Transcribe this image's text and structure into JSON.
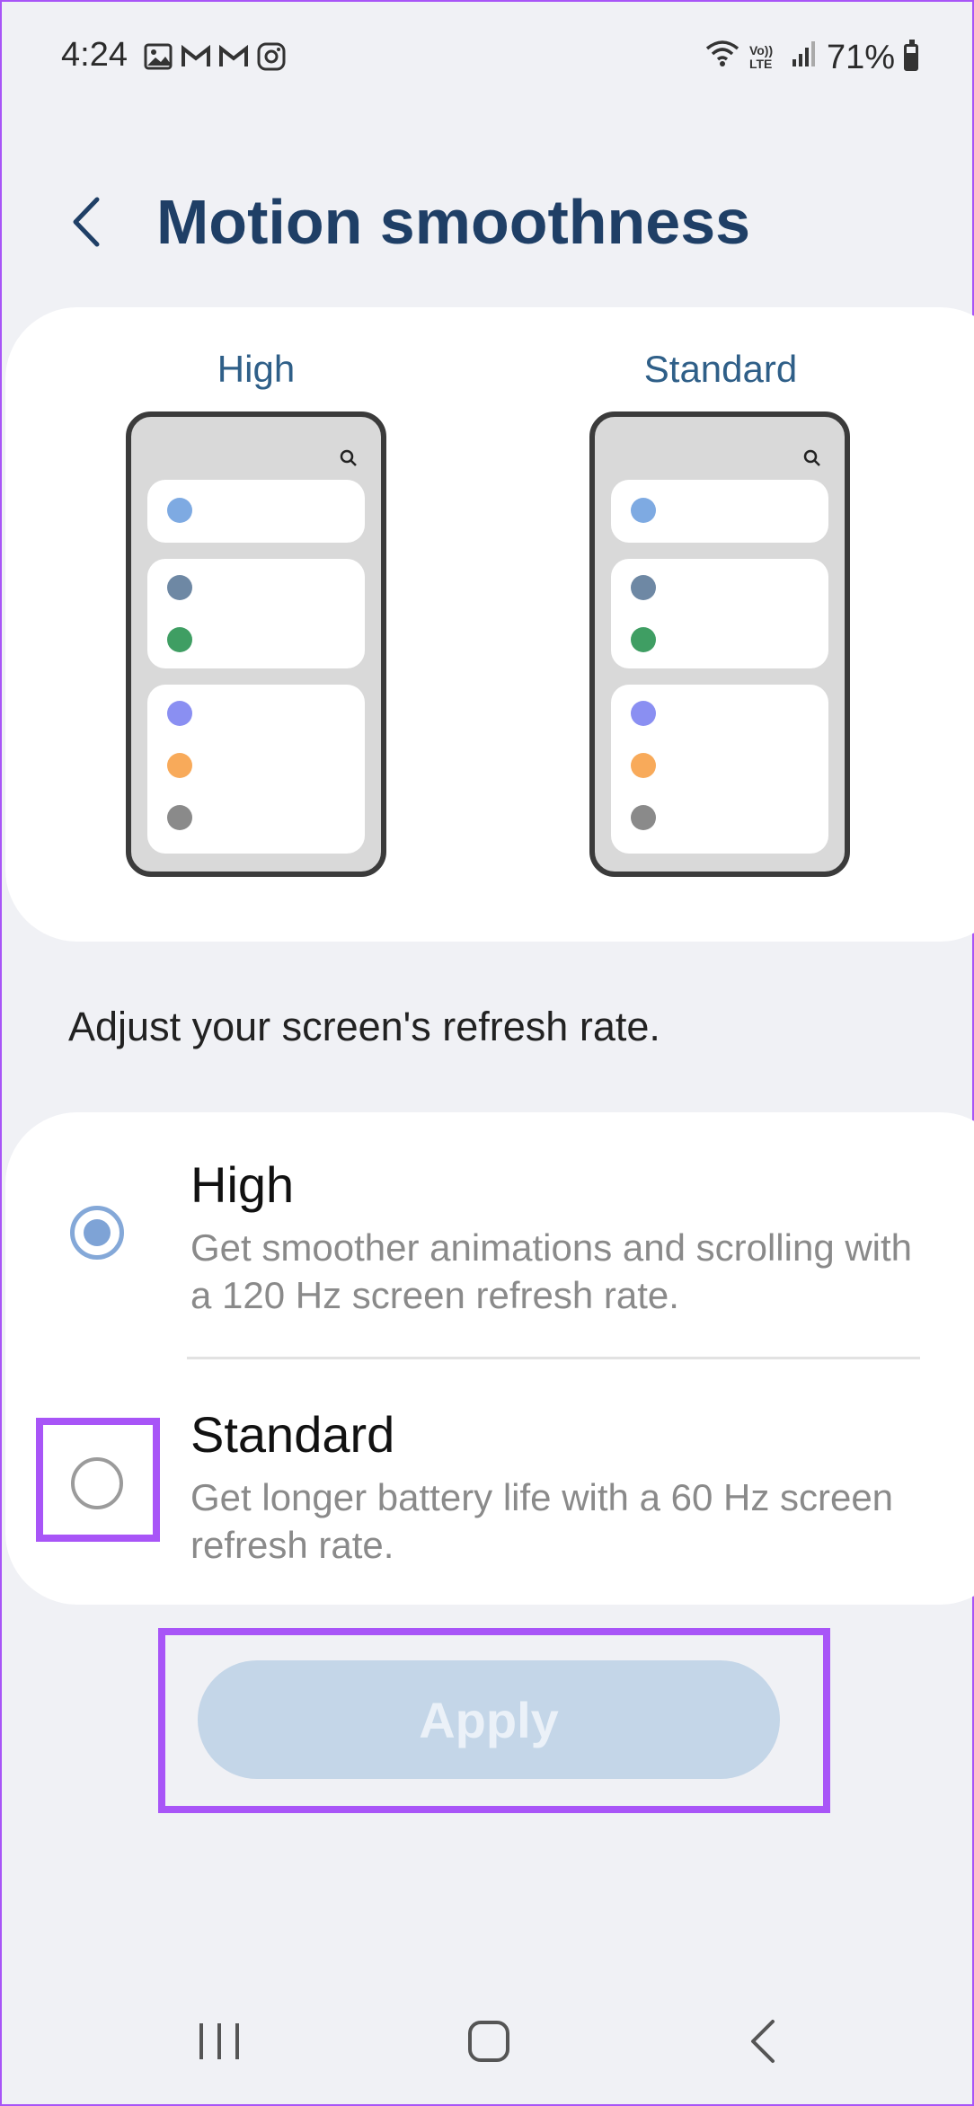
{
  "status_bar": {
    "time": "4:24",
    "battery": "71%",
    "icons_left": [
      "gallery-icon",
      "gmail-icon",
      "gmail-icon",
      "instagram-icon"
    ],
    "icons_right": [
      "wifi-icon",
      "volte-icon",
      "signal-icon",
      "battery-icon"
    ],
    "volte_text": "Vo)) LTE"
  },
  "header": {
    "title": "Motion smoothness"
  },
  "preview": {
    "high_label": "High",
    "standard_label": "Standard"
  },
  "description": "Adjust your screen's refresh rate.",
  "options": [
    {
      "title": "High",
      "description": "Get smoother animations and scrolling with a 120 Hz screen refresh rate.",
      "selected": true
    },
    {
      "title": "Standard",
      "description": "Get longer battery life with a 60 Hz screen refresh rate.",
      "selected": false
    }
  ],
  "apply_button": "Apply",
  "colors": {
    "accent": "#1f3f66",
    "highlight": "#a855f7",
    "apply_bg": "#c4d6e8",
    "radio": "#7ea3d6"
  },
  "navigation": [
    "recent-apps-icon",
    "home-icon",
    "back-icon"
  ]
}
